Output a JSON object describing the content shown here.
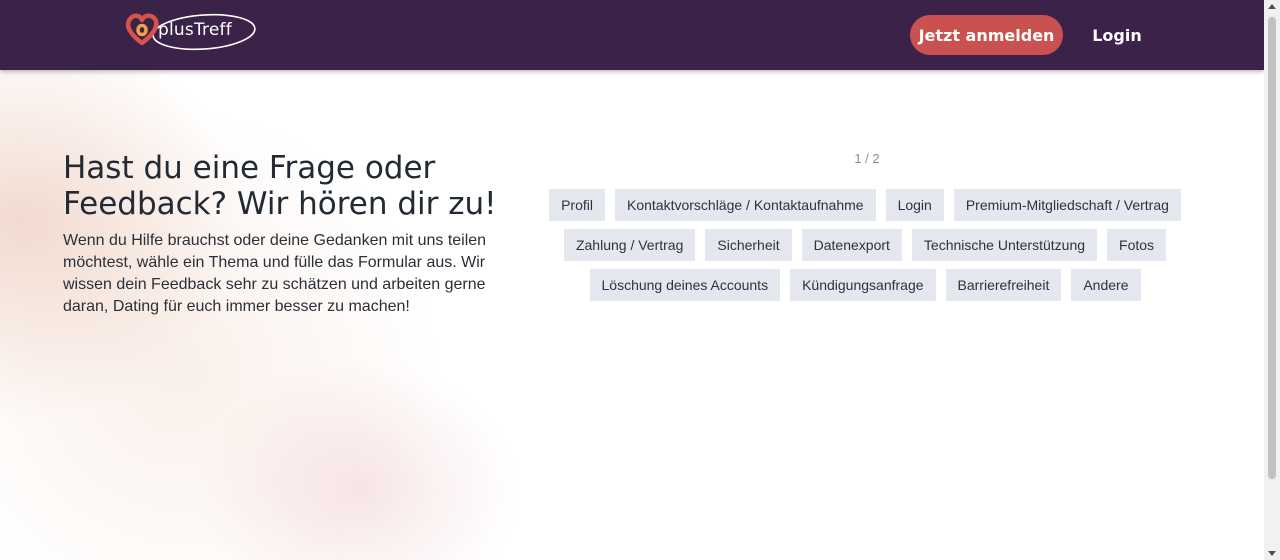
{
  "header": {
    "logo_text": "plusTreff",
    "register_label": "Jetzt anmelden",
    "login_label": "Login"
  },
  "hero": {
    "title": "Hast du eine Frage oder Feedback? Wir hören dir zu!",
    "text": "Wenn du Hilfe brauchst oder deine Gedanken mit uns teilen möchtest, wähle ein Thema und fülle das Formular aus. Wir wissen dein Feedback sehr zu schätzen und arbeiten gerne daran, Dating für euch immer besser zu machen!"
  },
  "pager": {
    "text": "1 / 2"
  },
  "topics": [
    "Profil",
    "Kontaktvorschläge / Kontaktaufnahme",
    "Login",
    "Premium-Mitgliedschaft / Vertrag",
    "Zahlung / Vertrag",
    "Sicherheit",
    "Datenexport",
    "Technische Unterstützung",
    "Fotos",
    "Löschung deines Accounts",
    "Kündigungsanfrage",
    "Barrierefreiheit",
    "Andere"
  ],
  "colors": {
    "header_bg": "#3b2249",
    "accent": "#c9514f",
    "topic_bg": "#e4e7ee"
  }
}
